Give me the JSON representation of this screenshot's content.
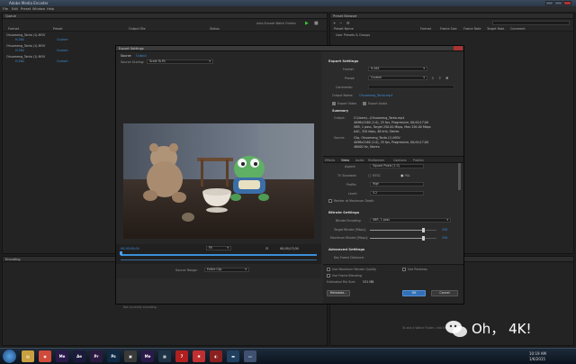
{
  "app_title": "Adobe Media Encoder",
  "menu": [
    "File",
    "Edit",
    "Preset",
    "Window",
    "Help"
  ],
  "queue": {
    "title": "Queue",
    "columns": [
      "Format",
      "Preset",
      "Output File",
      "Status"
    ],
    "auto_encode_label": "Auto-Encode Watch Folders",
    "items": [
      {
        "name": "Ohuomeng_Tanta (1)-MOV",
        "format": "H.264",
        "preset": "Custom",
        "status": ""
      },
      {
        "name": "Ohuomeng_Tanta (1)-MOV",
        "format": "H.264",
        "preset": "Custom",
        "status": ""
      },
      {
        "name": "Ohuomeng_Tanta (1)-MOV",
        "format": "H.264",
        "preset": "Custom",
        "status": ""
      }
    ]
  },
  "preset_browser": {
    "title": "Preset Browser",
    "columns": [
      "Preset Name",
      "Format",
      "Frame Size",
      "Frame Rate",
      "Target Rate",
      "Comment"
    ],
    "row": "User Presets & Groups"
  },
  "encoding": {
    "title": "Encoding",
    "none_label": "Not currently encoding."
  },
  "watch": {
    "hint": "To add a Watch Folder, click the Add button."
  },
  "dialog": {
    "title": "Export Settings",
    "tabs": [
      "Source",
      "Output"
    ],
    "source_scaling_label": "Source Scaling:",
    "source_scaling": "Scale To Fit",
    "timecode_left": "00;00;00;00",
    "fit": "Fit",
    "timecode_right": "00;00;17;00",
    "source_range_label": "Source Range:",
    "source_range": "Entire Clip",
    "export_settings_header": "Export Settings",
    "format_label": "Format:",
    "format": "H.264",
    "preset_label": "Preset:",
    "preset": "Custom",
    "comments_label": "Comments:",
    "output_name_label": "Output Name:",
    "output_name": "Ohuomeng_Tanta.mp4",
    "export_video": "Export Video",
    "export_audio": "Export Audio",
    "summary_label": "Summary",
    "output_label": "Output:",
    "output_text": [
      "C:\\Users\\...\\Ohuomeng_Tanta.mp4",
      "4096x2160 (1.0), 25 fps, Progressive, 00;00;17;00",
      "VBR, 1 pass, Target 250.00 Mbps, Max 250.00 Mbps",
      "AAC, 320 kbps, 48 kHz, Stereo"
    ],
    "source_label": "Source:",
    "source_text": [
      "Clip, Ohuomeng_Tanta (1)-MOV",
      "4096x2160 (1.0), 25 fps, Progressive, 00;00;17;00",
      "48000 Hz, Stereo"
    ],
    "panel_tabs": [
      "Effects",
      "Video",
      "Audio",
      "Multiplexer",
      "Captions",
      "Publish"
    ],
    "aspect_label": "Aspect:",
    "aspect": "Square Pixels (1.0)",
    "tv_label": "TV Standard:",
    "tv_ntsc": "NTSC",
    "tv_pal": "PAL",
    "profile_label": "Profile:",
    "profile": "High",
    "level_label": "Level:",
    "level": "5.2",
    "render_max_depth": "Render at Maximum Depth",
    "bitrate_header": "Bitrate Settings",
    "bitrate_encoding_label": "Bitrate Encoding:",
    "bitrate_encoding": "VBR, 1 pass",
    "target_bitrate_label": "Target Bitrate [Mbps]:",
    "target_bitrate": "250",
    "target_bitrate_fill": 0.8,
    "max_bitrate_label": "Maximum Bitrate [Mbps]:",
    "max_bitrate": "250",
    "max_bitrate_fill": 0.8,
    "advanced_header": "Advanced Settings",
    "keyframe_label": "Key Frame Distance:",
    "use_max_render": "Use Maximum Render Quality",
    "use_previews": "Use Previews",
    "use_frame_blending": "Use Frame Blending",
    "file_size_label": "Estimated File Size:",
    "file_size": "531 MB",
    "metadata_btn": "Metadata...",
    "ok_btn": "OK",
    "cancel_btn": "Cancel"
  },
  "taskbar": {
    "icons": [
      {
        "name": "explorer",
        "glyph": "▤",
        "color": "#c9a040"
      },
      {
        "name": "chrome",
        "glyph": "◉",
        "color": "#d04a3a"
      },
      {
        "name": "media-encoder",
        "glyph": "Me",
        "color": "#2a1a4a"
      },
      {
        "name": "after-effects",
        "glyph": "Ae",
        "color": "#1c1a3c"
      },
      {
        "name": "premiere",
        "glyph": "Pr",
        "color": "#2a1a40"
      },
      {
        "name": "photoshop",
        "glyph": "Ps",
        "color": "#0f2a44"
      },
      {
        "name": "app-7",
        "glyph": "▣",
        "color": "#3a3a3a"
      },
      {
        "name": "media-encoder-2",
        "glyph": "Me",
        "color": "#2a1a4a"
      },
      {
        "name": "app-9",
        "glyph": "▦",
        "color": "#1f3346"
      },
      {
        "name": "app-10",
        "glyph": "7",
        "color": "#b02020"
      },
      {
        "name": "app-11",
        "glyph": "✱",
        "color": "#c03030"
      },
      {
        "name": "app-12",
        "glyph": "◐",
        "color": "#8a2020"
      },
      {
        "name": "app-13",
        "glyph": "▬",
        "color": "#204060"
      },
      {
        "name": "app-14",
        "glyph": "▭",
        "color": "#405070"
      }
    ],
    "clock_time": "10:19 AM",
    "clock_date": "1/6/2015"
  },
  "watermark": {
    "text": "Oh， 4K!"
  },
  "colors": {
    "accent": "#3f8fd6",
    "ok": "#3270b8"
  }
}
